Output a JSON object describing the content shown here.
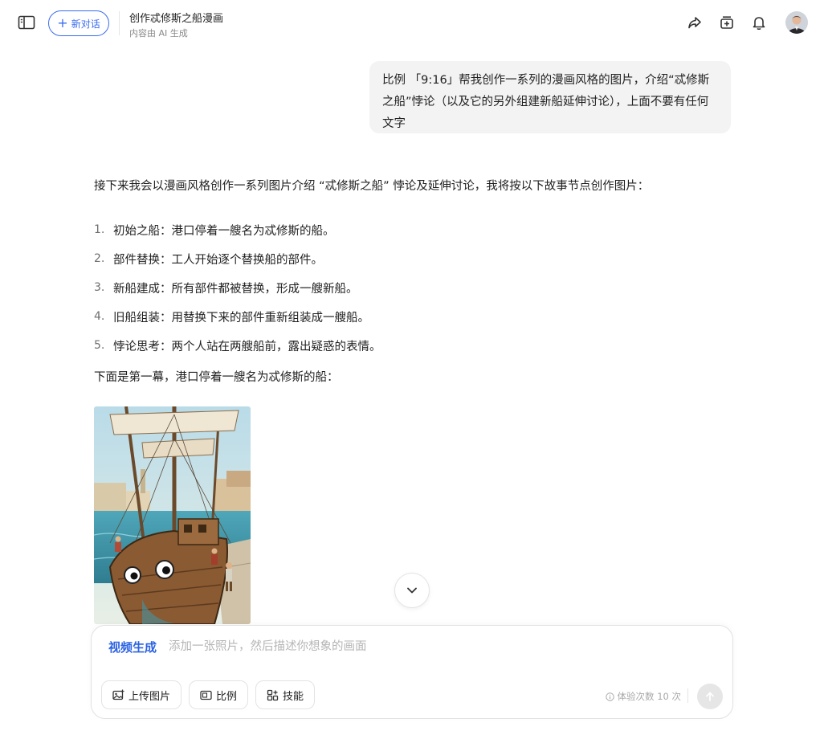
{
  "header": {
    "new_chat_label": "新对话",
    "conversation_title": "创作忒修斯之船漫画",
    "conversation_subtitle": "内容由 AI 生成"
  },
  "user_message": "比例 「9:16」帮我创作一系列的漫画风格的图片，介绍“忒修斯之船”悖论（以及它的另外组建新船延伸讨论），上面不要有任何文字",
  "answer": {
    "intro": "接下来我会以漫画风格创作一系列图片介绍 “忒修斯之船” 悖论及延伸讨论，我将按以下故事节点创作图片：",
    "steps": [
      {
        "num": "1.",
        "text": "初始之船：港口停着一艘名为忒修斯的船。"
      },
      {
        "num": "2.",
        "text": "部件替换：工人开始逐个替换船的部件。"
      },
      {
        "num": "3.",
        "text": "新船建成：所有部件都被替换，形成一艘新船。"
      },
      {
        "num": "4.",
        "text": "旧船组装：用替换下来的部件重新组装成一艘船。"
      },
      {
        "num": "5.",
        "text": "悖论思考：两个人站在两艘船前，露出疑惑的表情。"
      }
    ],
    "act_line": "下面是第一幕，港口停着一艘名为忒修斯的船："
  },
  "composer": {
    "mode_label": "视频生成",
    "placeholder": "添加一张照片，然后描述你想象的画面",
    "tools": {
      "upload": "上传图片",
      "ratio": "比例",
      "skills": "技能"
    },
    "quota": "体验次数 10 次"
  },
  "icons": {
    "sidebar": "sidebar-toggle-icon",
    "share": "share-icon",
    "add_to_collection": "add-collection-icon",
    "notifications": "bell-icon",
    "scroll": "chevron-down-icon",
    "send": "arrow-up-icon"
  },
  "colors": {
    "accent": "#3b6cf0",
    "mode_label": "#2b62e3",
    "bubble_bg": "#f3f3f3"
  }
}
